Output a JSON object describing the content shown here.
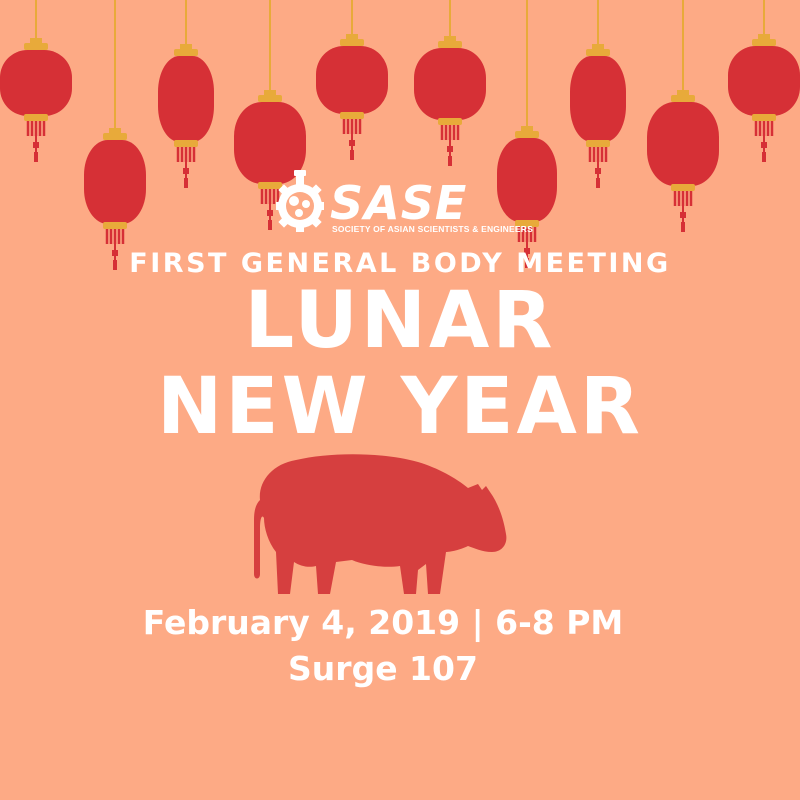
{
  "logo": {
    "name": "SASE",
    "tagline": "SOCIETY OF ASIAN SCIENTISTS & ENGINEERS"
  },
  "subtitle": "FIRST GENERAL BODY MEETING",
  "title_line1": "LUNAR",
  "title_line2": "NEW YEAR",
  "date_time": "February 4, 2019 | 6-8 PM",
  "location": "Surge 107",
  "colors": {
    "background": "#FDAA85",
    "lantern": "#D63036",
    "gold": "#E8AA3A",
    "pig": "#D63F3F",
    "text": "#FFFFFF"
  },
  "decorations": [
    "hanging-lanterns",
    "pig-silhouette",
    "sase-logo"
  ]
}
